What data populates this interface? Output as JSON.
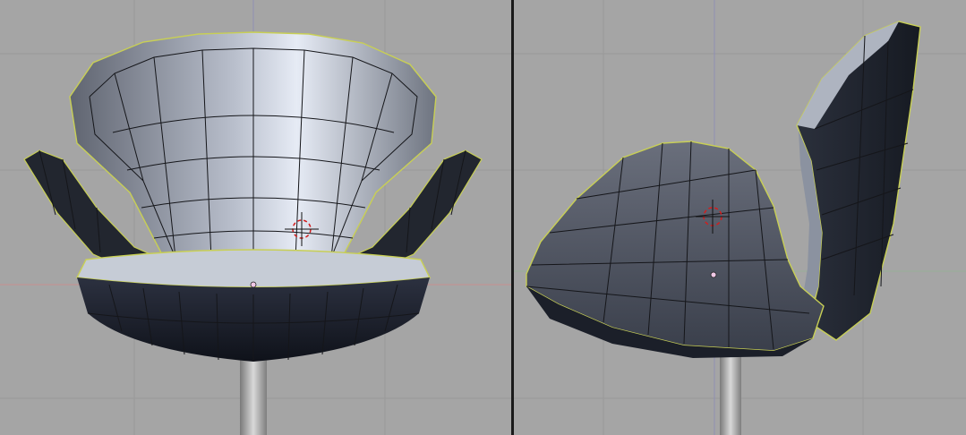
{
  "viewports": [
    {
      "id": "front",
      "view": "front",
      "object": "chair-mesh"
    },
    {
      "id": "side",
      "view": "side",
      "object": "chair-mesh"
    }
  ],
  "colors": {
    "viewport_background": "#a5a5a5",
    "grid_line": "#999999",
    "x_axis": "#c88f8f",
    "z_axis": "#8e8eb4",
    "y_axis": "#96b096",
    "selected_edge": "#c8cf55",
    "wire": "#15161a",
    "cursor_ring": "#d21e1e",
    "object_origin": "#f0c8e6"
  },
  "icons": {
    "cursor": "3d-cursor-icon",
    "origin": "object-origin-icon"
  }
}
